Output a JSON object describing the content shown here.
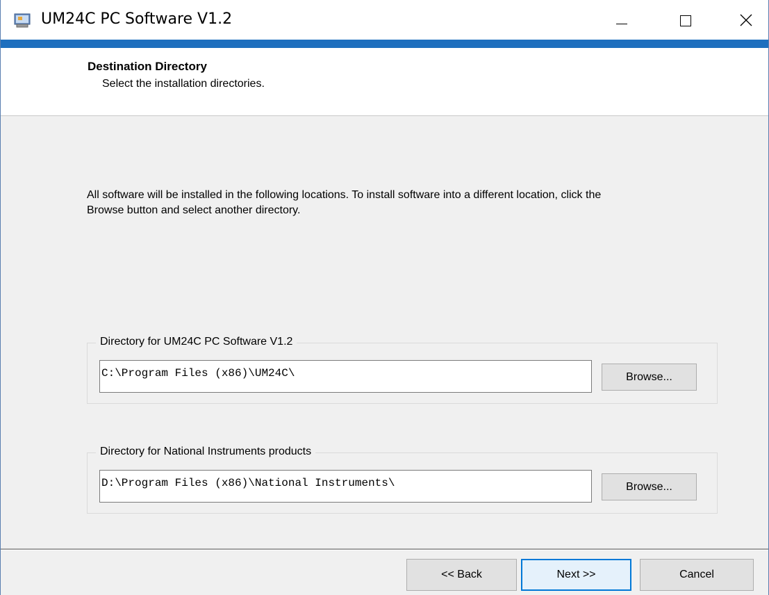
{
  "window": {
    "title": "UM24C PC Software V1.2",
    "accent_color": "#1e6fbe",
    "controls": {
      "minimize": "minimize-icon",
      "maximize": "maximize-icon",
      "close": "close-icon"
    }
  },
  "header": {
    "title": "Destination Directory",
    "subtitle": "Select the installation directories."
  },
  "body": {
    "description": "All software will be installed in the following locations. To install software into a different location, click the Browse button and select another directory."
  },
  "directories": [
    {
      "label": "Directory for UM24C PC Software V1.2",
      "path": "C:\\Program Files (x86)\\UM24C\\",
      "browse_label": "Browse..."
    },
    {
      "label": "Directory for National Instruments products",
      "path": "D:\\Program Files (x86)\\National Instruments\\",
      "browse_label": "Browse..."
    }
  ],
  "footer": {
    "back_label": "<< Back",
    "next_label": "Next >>",
    "cancel_label": "Cancel"
  }
}
